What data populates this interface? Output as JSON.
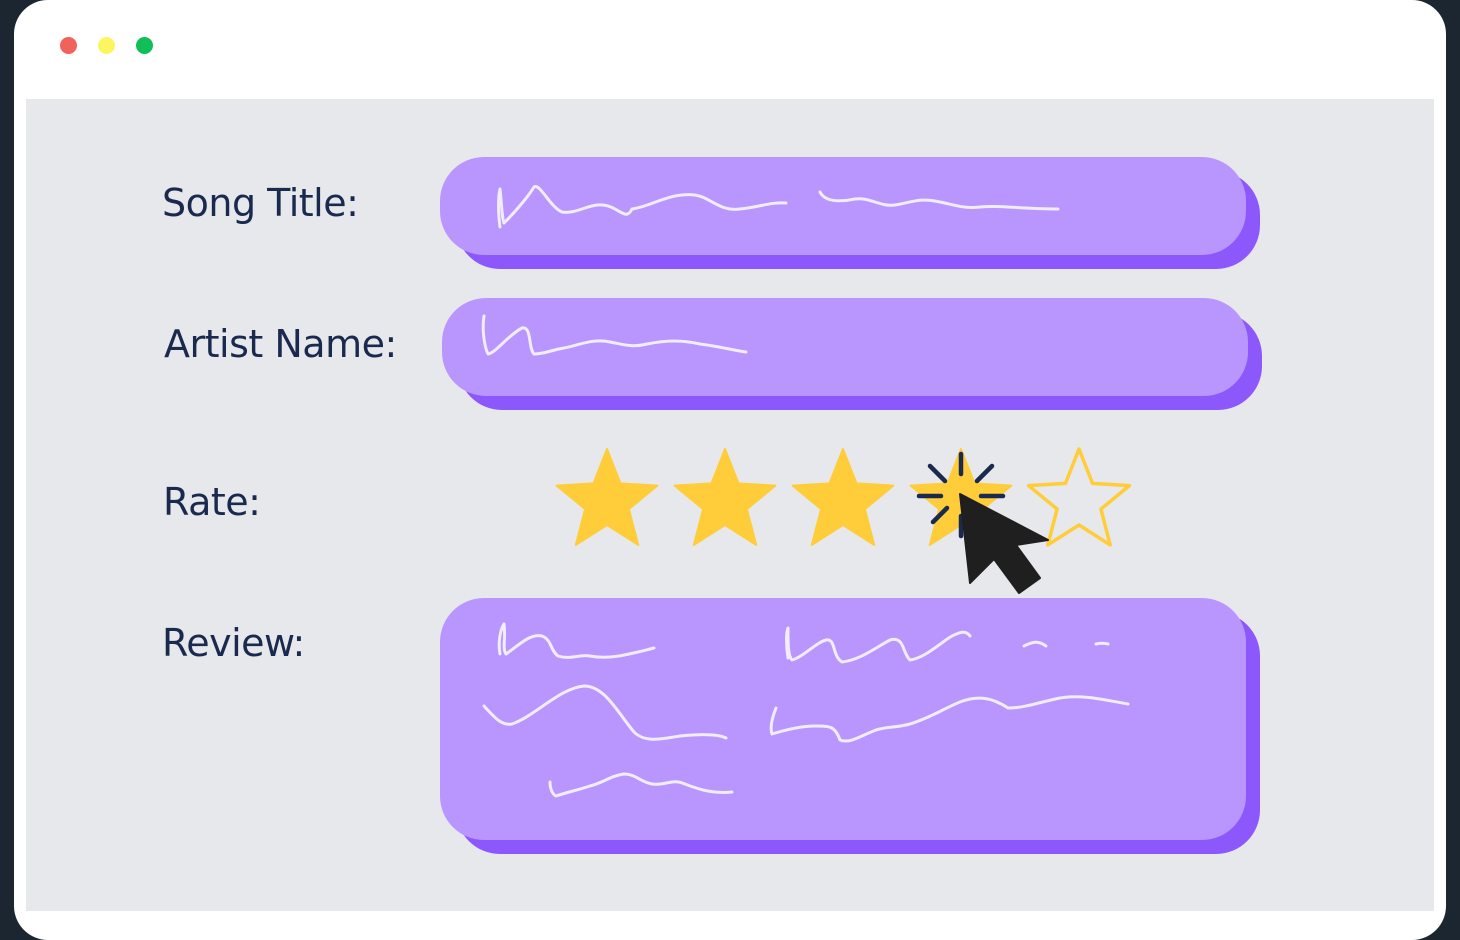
{
  "window": {
    "controls": [
      {
        "name": "close",
        "color": "#f0625b"
      },
      {
        "name": "minimize",
        "color": "#fdf55f"
      },
      {
        "name": "maximize",
        "color": "#10bf57"
      }
    ]
  },
  "form": {
    "song_title_label": "Song Title:",
    "artist_name_label": "Artist Name:",
    "rate_label": "Rate:",
    "review_label": "Review:"
  },
  "rating": {
    "max": 5,
    "value": 4,
    "filled_color": "#ffcc3a",
    "empty_stroke_color": "#ffcc3a"
  },
  "colors": {
    "field_fill": "#b896fd",
    "field_shadow": "#8c57fb",
    "scribble": "#f1ecff",
    "label_text": "#1a2a4e",
    "cursor": "#1f1f1f",
    "click_burst": "#1a2a4e"
  },
  "icons": {
    "cursor": "arrow-cursor-icon",
    "click": "click-burst-icon",
    "star": "star-icon"
  }
}
